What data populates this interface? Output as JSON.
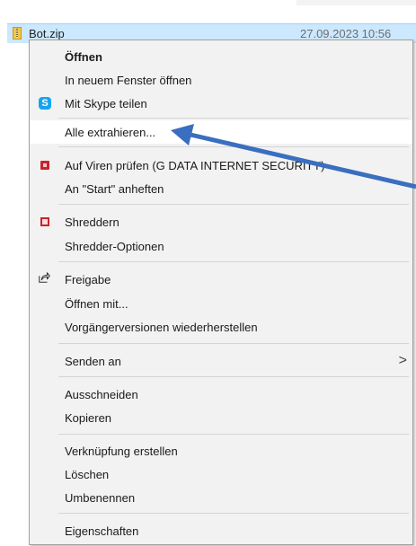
{
  "file": {
    "name": "Bot.zip",
    "date": "27.09.2023 10:56"
  },
  "menu": {
    "items": [
      {
        "label": "Öffnen"
      },
      {
        "label": "In neuem Fenster öffnen"
      },
      {
        "label": "Mit Skype teilen"
      },
      {
        "label": "Alle extrahieren..."
      },
      {
        "label": "Auf Viren prüfen (G DATA INTERNET SECURITY)"
      },
      {
        "label": "An \"Start\" anheften"
      },
      {
        "label": "Shreddern"
      },
      {
        "label": "Shredder-Optionen"
      },
      {
        "label": "Freigabe"
      },
      {
        "label": "Öffnen mit..."
      },
      {
        "label": "Vorgängerversionen wiederherstellen"
      },
      {
        "label": "Senden an"
      },
      {
        "label": "Ausschneiden"
      },
      {
        "label": "Kopieren"
      },
      {
        "label": "Verknüpfung erstellen"
      },
      {
        "label": "Löschen"
      },
      {
        "label": "Umbenennen"
      },
      {
        "label": "Eigenschaften"
      }
    ],
    "skype_glyph": "S",
    "submenu_chevron": ">"
  },
  "colors": {
    "selection": "#cce8ff",
    "menu_bg": "#f2f2f2",
    "hover": "#ffffff",
    "arrow": "#3a6ec0"
  },
  "icons": {
    "zip": "zip-folder-icon",
    "skype": "skype-icon",
    "gdata": "gdata-shield-icon",
    "shredder": "shredder-icon",
    "share": "share-icon",
    "chevron": "chevron-right-icon",
    "annotation": "annotation-arrow"
  }
}
